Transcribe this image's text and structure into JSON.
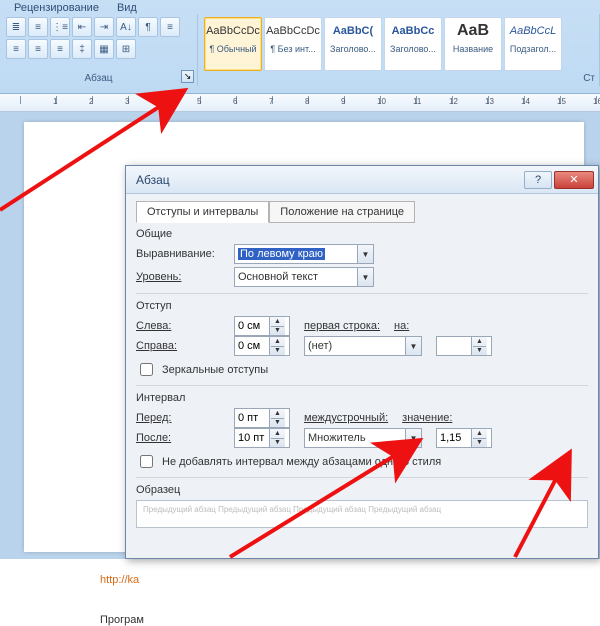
{
  "ribbon": {
    "tabs": [
      "Рецензирование",
      "Вид"
    ],
    "paragraph_group_label": "Абзац",
    "styles_group_label": "Ст",
    "styles": [
      {
        "preview": "AaBbCcDc",
        "name": "¶ Обычный"
      },
      {
        "preview": "AaBbCcDc",
        "name": "¶ Без инт..."
      },
      {
        "preview": "AaBbC(",
        "name": "Заголово..."
      },
      {
        "preview": "AaBbCc",
        "name": "Заголово..."
      },
      {
        "preview": "AaB",
        "name": "Название"
      },
      {
        "preview": "AaBbCcL",
        "name": "Подзагол..."
      }
    ]
  },
  "doc": {
    "url": "http://ka",
    "line": "Програм"
  },
  "dialog": {
    "title": "Абзац",
    "help": "?",
    "close": "✕",
    "tab1": "Отступы и интервалы",
    "tab2": "Положение на странице",
    "general": "Общие",
    "align_lbl": "Выравнивание:",
    "align_val": "По левому краю",
    "level_lbl": "Уровень:",
    "level_val": "Основной текст",
    "indent": "Отступ",
    "left_lbl": "Слева:",
    "left_val": "0 см",
    "right_lbl": "Справа:",
    "right_val": "0 см",
    "first_lbl": "первая строка:",
    "first_val": "(нет)",
    "on_lbl": "на:",
    "on_val": "",
    "mirror": "Зеркальные отступы",
    "interval": "Интервал",
    "before_lbl": "Перед:",
    "before_val": "0 пт",
    "after_lbl": "После:",
    "after_val": "10 пт",
    "linesp_lbl": "междустрочный:",
    "linesp_val": "Множитель",
    "value_lbl": "значение:",
    "value_val": "1,15",
    "noadd": "Не добавлять интервал между абзацами одного стиля",
    "sample": "Образец",
    "sample_txt": "Предыдущий абзац Предыдущий абзац Предыдущий абзац Предыдущий абзац"
  }
}
